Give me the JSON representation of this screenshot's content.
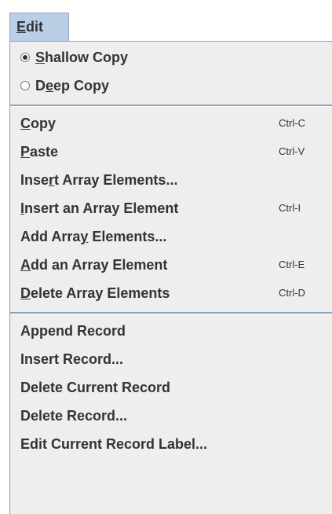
{
  "menubar": {
    "edit_menu": {
      "mnemonic": "E",
      "rest": "dit"
    }
  },
  "menu": {
    "copy_mode": {
      "shallow": {
        "before": "",
        "mnemonic": "S",
        "after": "hallow Copy",
        "checked": true
      },
      "deep": {
        "before": "D",
        "mnemonic": "e",
        "after": "ep Copy",
        "checked": false
      }
    },
    "edit_items": [
      {
        "before": "",
        "mnemonic": "C",
        "after": "opy",
        "shortcut": "Ctrl-C"
      },
      {
        "before": "",
        "mnemonic": "P",
        "after": "aste",
        "shortcut": "Ctrl-V"
      },
      {
        "before": "Inse",
        "mnemonic": "r",
        "after": "t Array Elements...",
        "shortcut": ""
      },
      {
        "before": "",
        "mnemonic": "I",
        "after": "nsert an Array Element",
        "shortcut": "Ctrl-I"
      },
      {
        "before": "Add Arra",
        "mnemonic": "y",
        "after": " Elements...",
        "shortcut": ""
      },
      {
        "before": "",
        "mnemonic": "A",
        "after": "dd an Array Element",
        "shortcut": "Ctrl-E"
      },
      {
        "before": "",
        "mnemonic": "D",
        "after": "elete Array Elements",
        "shortcut": "Ctrl-D"
      }
    ],
    "record_items": [
      "Append Record",
      "Insert Record...",
      "Delete Current Record",
      "Delete Record...",
      "Edit Current Record Label..."
    ]
  }
}
